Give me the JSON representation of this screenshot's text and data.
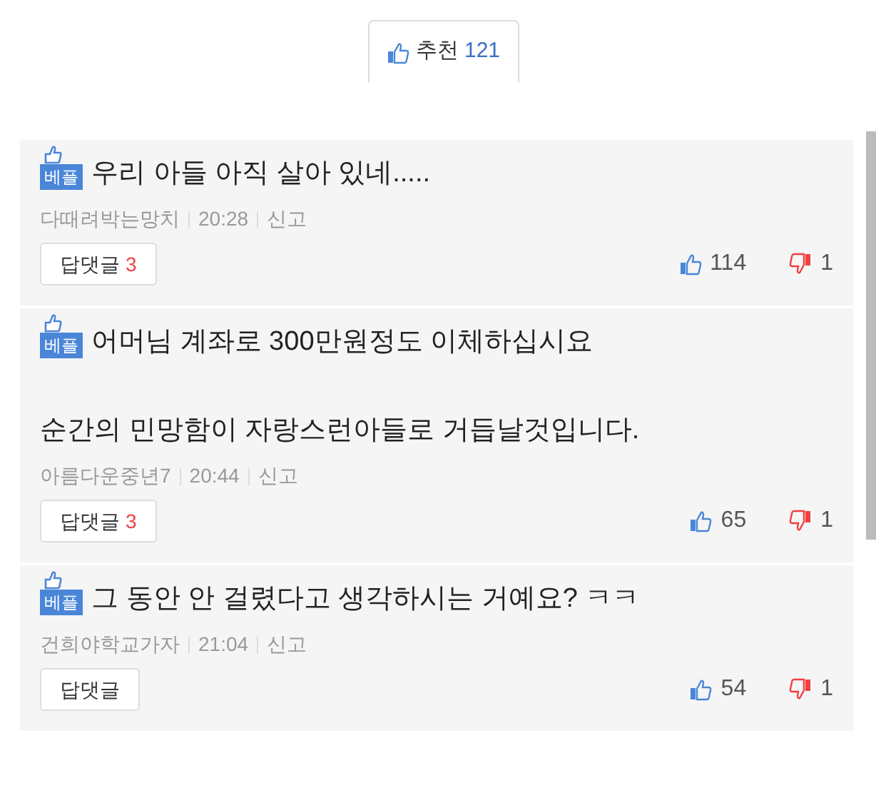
{
  "recommend": {
    "label": "추천",
    "count": "121"
  },
  "comments": [
    {
      "badge": "베플",
      "paragraphs": [
        "우리 아들 아직 살아 있네....."
      ],
      "author": "다때려박는망치",
      "time": "20:28",
      "report": "신고",
      "reply_label": "답댓글",
      "reply_count": "3",
      "likes": "114",
      "dislikes": "1"
    },
    {
      "badge": "베플",
      "paragraphs": [
        "어머님 계좌로 300만원정도 이체하십시요",
        "순간의 민망함이 자랑스런아들로 거듭날것입니다."
      ],
      "author": "아름다운중년7",
      "time": "20:44",
      "report": "신고",
      "reply_label": "답댓글",
      "reply_count": "3",
      "likes": "65",
      "dislikes": "1"
    },
    {
      "badge": "베플",
      "paragraphs": [
        "그 동안 안 걸렸다고 생각하시는 거예요? ㅋㅋ"
      ],
      "author": "건희야학교가자",
      "time": "21:04",
      "report": "신고",
      "reply_label": "답댓글",
      "likes": "54",
      "dislikes": "1"
    }
  ]
}
